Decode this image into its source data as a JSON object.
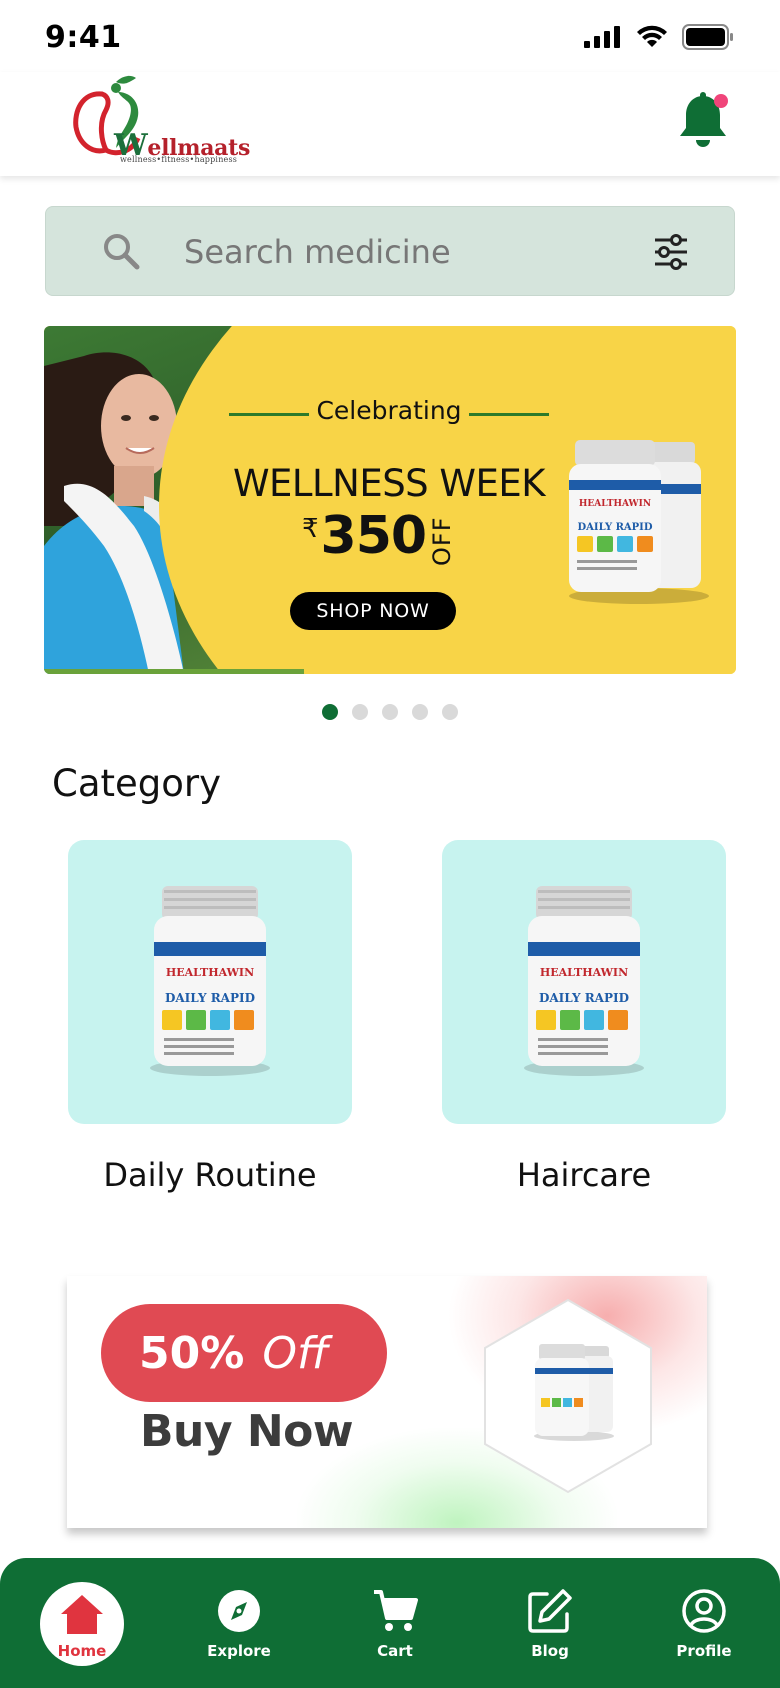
{
  "status_bar": {
    "time": "9:41"
  },
  "header": {
    "logo_wordmark": "ellmaats",
    "logo_initial": "W",
    "logo_tagline": "wellness•fitness•happiness",
    "has_notification": true
  },
  "search": {
    "placeholder": "Search medicine"
  },
  "hero": {
    "celebrating": "Celebrating",
    "headline": "WELLNESS WEEK",
    "currency": "₹",
    "amount": "350",
    "off": "OFF",
    "cta": "SHOP NOW",
    "product_brand": "HEALTHAWIN",
    "product_name": "DAILY RAPID",
    "dots_total": 5,
    "active_dot": 1
  },
  "category": {
    "title": "Category",
    "items": [
      {
        "label": "Daily Routine",
        "product_brand": "HEALTHAWIN",
        "product_name": "DAILY RAPID"
      },
      {
        "label": "Haircare",
        "product_brand": "HEALTHAWIN",
        "product_name": "DAILY RAPID"
      }
    ]
  },
  "promo": {
    "percent": "50%",
    "off": "Off",
    "cta": "Buy Now"
  },
  "nav": {
    "items": [
      {
        "label": "Home",
        "icon": "home-icon",
        "active": true
      },
      {
        "label": "Explore",
        "icon": "compass-icon",
        "active": false
      },
      {
        "label": "Cart",
        "icon": "cart-icon",
        "active": false
      },
      {
        "label": "Blog",
        "icon": "edit-icon",
        "active": false
      },
      {
        "label": "Profile",
        "icon": "user-circle-icon",
        "active": false
      }
    ]
  },
  "colors": {
    "brand_green": "#0f6e35",
    "brand_red": "#e04a53",
    "banner_yellow": "#f8d447",
    "category_bg": "#c7f3ef",
    "search_bg": "#d5e4dc",
    "notification_dot": "#f0457a"
  }
}
